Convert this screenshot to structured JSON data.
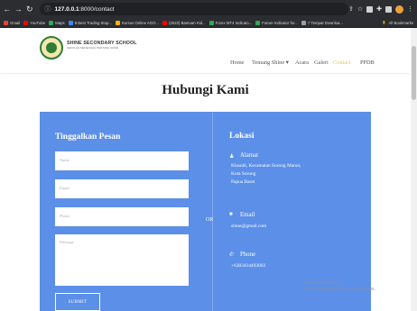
{
  "browser": {
    "url_host": "127.0.0.1",
    "url_rest": ":8000/contact",
    "bookmarks": [
      {
        "label": "Gmail",
        "color": "#ea4335"
      },
      {
        "label": "YouTube",
        "color": "#ff0000"
      },
      {
        "label": "Maps",
        "color": "#34a853"
      },
      {
        "label": "9 Best Trading Stop...",
        "color": "#4285f4"
      },
      {
        "label": "Kursus Online AGO...",
        "color": "#f4b400"
      },
      {
        "label": "(2022) Bantuan Kid...",
        "color": "#ff0000"
      },
      {
        "label": "Forex MT4 Indicato...",
        "color": "#34a853"
      },
      {
        "label": "Future Indicator for...",
        "color": "#34a853"
      },
      {
        "label": "7 Tempat Downloa...",
        "color": "#9aa0a6"
      }
    ],
    "all_bookmarks": "All Bookmarks"
  },
  "site": {
    "school_name": "SHINE SECONDARY SCHOOL",
    "school_sub": "SEKOLAH MENENGAH PERTAMA SHINE",
    "menu": [
      {
        "label": "Home",
        "active": false
      },
      {
        "label": "Tentang Shine ▾",
        "active": false
      },
      {
        "label": "Acara",
        "active": false
      },
      {
        "label": "Galeri",
        "active": false
      },
      {
        "label": "Contact",
        "active": true
      },
      {
        "label": "PPDB",
        "active": false
      }
    ]
  },
  "page": {
    "title": "Hubungi Kami"
  },
  "form": {
    "title": "Tinggalkan Pesan",
    "name_placeholder": "Name",
    "email_placeholder": "Email",
    "phone_placeholder": "Phone",
    "message_placeholder": "Message",
    "submit_label": "SUBMIT",
    "or_label": "OR"
  },
  "location": {
    "title": "Lokasi",
    "address_head": "Alamat",
    "address_lines": [
      "Klasubi, Kecamatan Sorong Manoi,",
      "Kota Sorong",
      "Papua Barat"
    ],
    "email_head": "Email",
    "email_value": "shine@gmail.com",
    "phone_head": "Phone",
    "phone_value": "+6283434493003"
  },
  "watermark": {
    "line1": "Activate Windows",
    "line2": "Go to Settings to activate Windows."
  },
  "colors": {
    "panel": "#5b8fe8",
    "active_menu": "#e6c84a"
  }
}
